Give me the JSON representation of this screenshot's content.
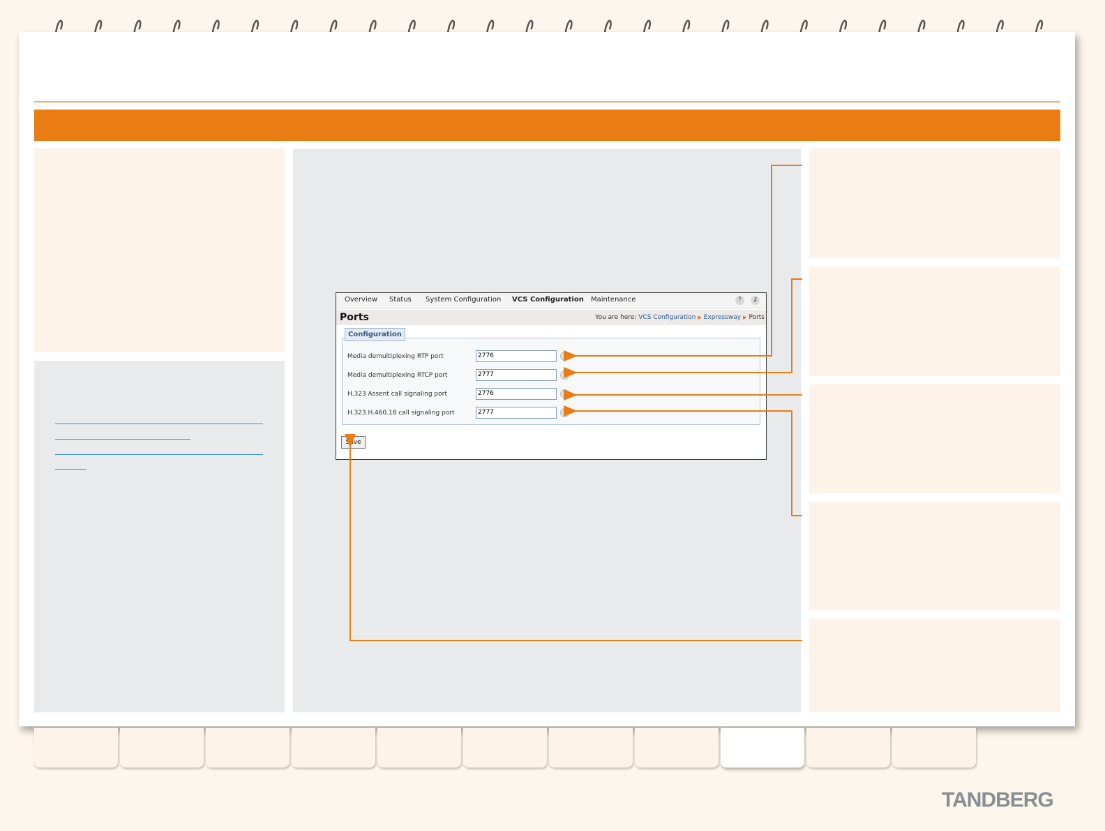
{
  "ui": {
    "nav": [
      "Overview",
      "Status",
      "System Configuration",
      "VCS Configuration",
      "Maintenance"
    ],
    "active_nav": "VCS Configuration",
    "help_icon": "?",
    "logout_icon": "key-icon",
    "page_title": "Ports",
    "breadcrumb": {
      "prefix": "You are here:",
      "items": [
        "VCS Configuration",
        "Expressway",
        "Ports"
      ]
    },
    "section_label": "Configuration",
    "fields": [
      {
        "label": "Media demultiplexing RTP port",
        "value": "2776"
      },
      {
        "label": "Media demultiplexing RTCP port",
        "value": "2777"
      },
      {
        "label": "H.323 Assent call signaling port",
        "value": "2776"
      },
      {
        "label": "H.323 H.460.18 call signaling port",
        "value": "2777"
      }
    ],
    "info_icon": "i",
    "save_label": "Save"
  },
  "brand": "TANDBERG",
  "colors": {
    "accent": "#ea7c14",
    "callout": "#ea7c14",
    "link": "#3a8fc8"
  }
}
